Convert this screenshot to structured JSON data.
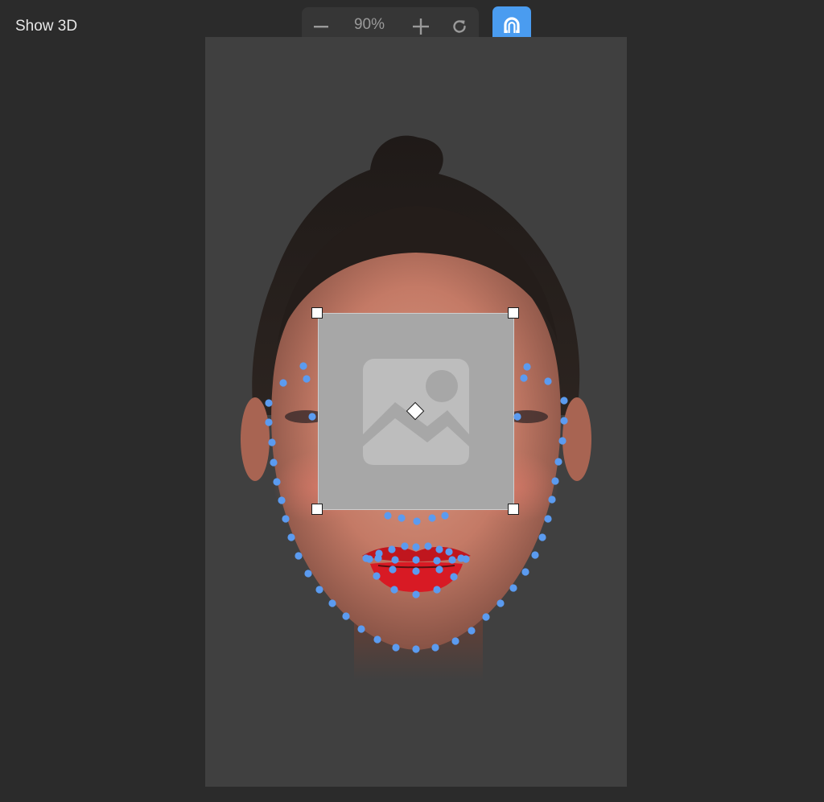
{
  "toolbar": {
    "show3d_label": "Show 3D",
    "zoom": {
      "value": "90%",
      "minus_icon": "minus-icon",
      "plus_icon": "plus-icon",
      "reset_icon": "rotate-icon"
    },
    "magnet_icon": "magnet-icon",
    "accent_color": "#4a9cf0"
  },
  "canvas": {
    "placeholder_icon": "image-placeholder-icon",
    "landmark_color": "#5b9bf0"
  }
}
